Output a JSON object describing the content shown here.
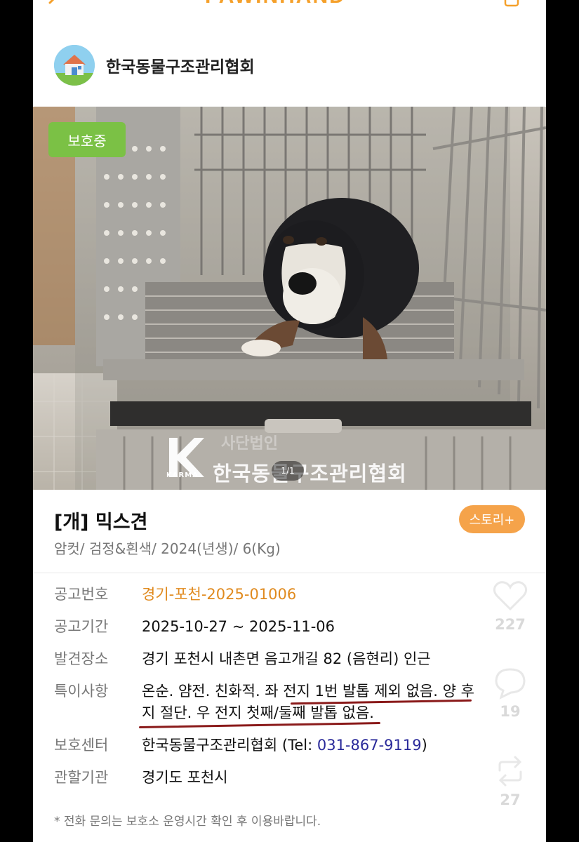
{
  "header": {
    "app_name": "PAWINHAND",
    "org_name": "한국동물구조관리협회"
  },
  "photo": {
    "status_badge": "보호중",
    "page_indicator": "1/1",
    "watermark_org": "한국동물구조관리협회",
    "watermark_sub": "사단법인",
    "watermark_brand": "KARMA"
  },
  "animal": {
    "title": "[개] 믹스견",
    "story_button": "스토리+",
    "meta": "암컷/ 검정&흰색/ 2024(년생)/ 6(Kg)"
  },
  "info": {
    "notice_no": {
      "label": "공고번호",
      "value": "경기-포천-2025-01006"
    },
    "notice_period": {
      "label": "공고기간",
      "value": "2025-10-27 ~ 2025-11-06"
    },
    "found_place": {
      "label": "발견장소",
      "value": "경기 포천시 내촌면 음고개길 82 (음현리) 인근"
    },
    "notes": {
      "label": "특이사항",
      "line1": "온순. 얌전. 친화적. 좌 전지 1번 발톱 제외 없음. 양 후",
      "line2": "지 절단. 우 전지 첫째/둘째 발톱 없음."
    },
    "center": {
      "label": "보호센터",
      "value_prefix": "한국동물구조관리협회 (Tel: ",
      "phone": "031-867-9119",
      "value_suffix": ")"
    },
    "authority": {
      "label": "관할기관",
      "value": "경기도 포천시"
    }
  },
  "footnote": "* 전화 문의는 보호소 운영시간 확인 후 이용바랍니다.",
  "side": {
    "likes": "227",
    "comments": "19",
    "shares": "27"
  },
  "colors": {
    "accent_orange": "#f5a34a",
    "badge_green": "#7bc145",
    "notice_orange": "#e08a1e",
    "phone_blue": "#2a2a9a",
    "underline_red": "#8a1a1a"
  }
}
